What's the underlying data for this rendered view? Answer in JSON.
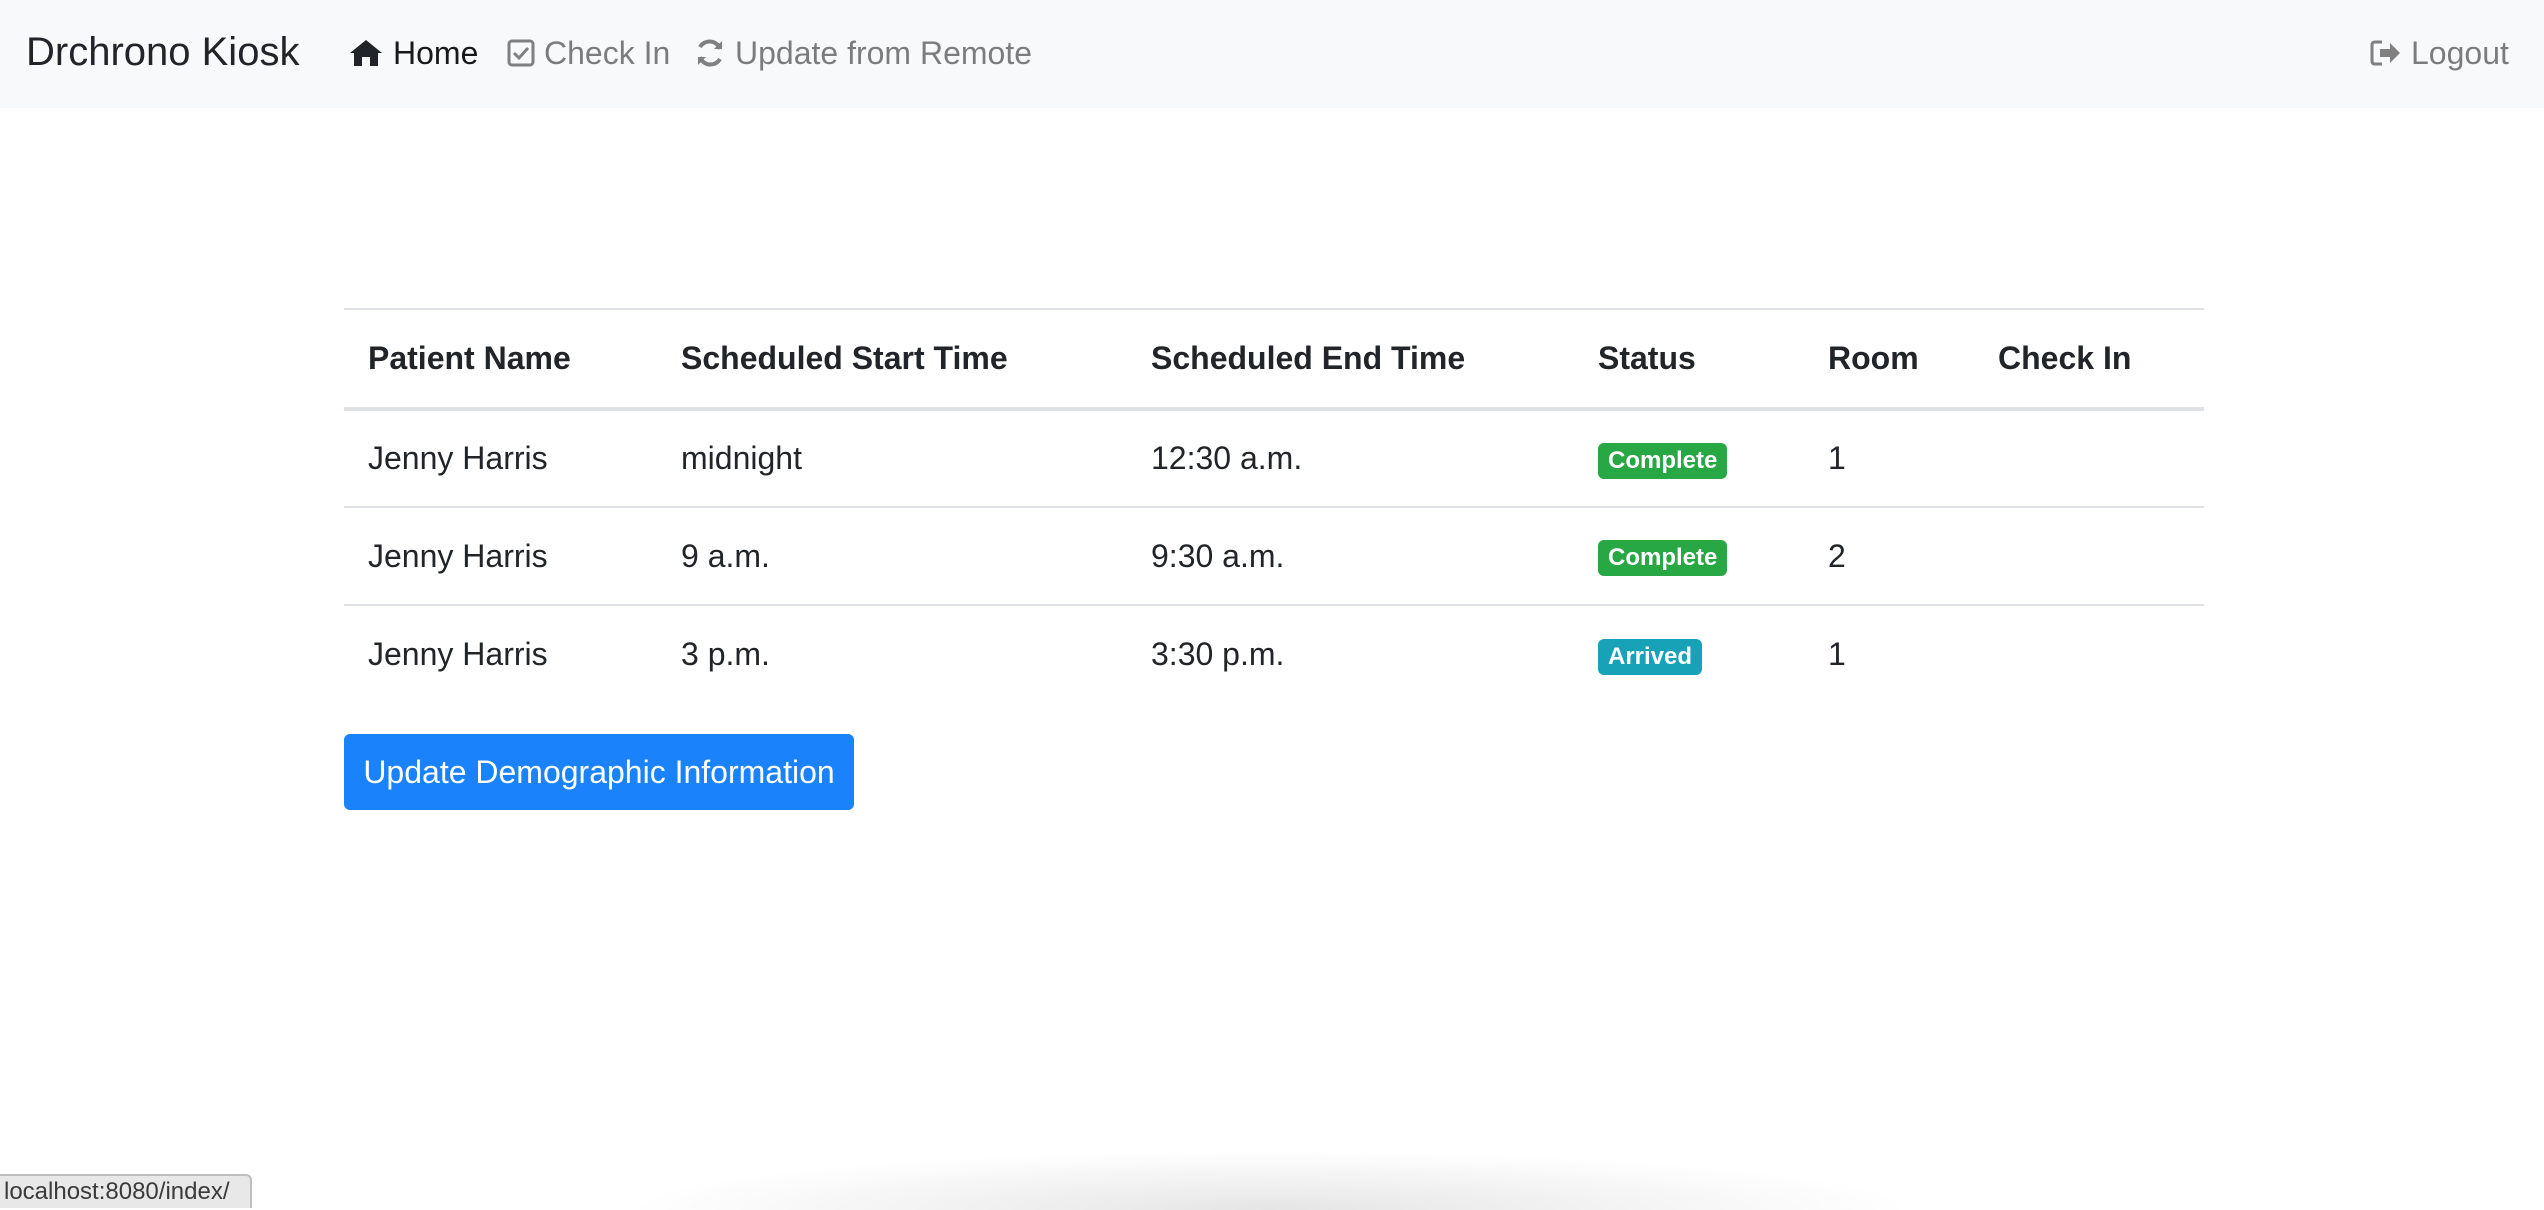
{
  "navbar": {
    "brand": "Drchrono Kiosk",
    "links": [
      {
        "label": "Home",
        "icon": "home-icon",
        "active": true
      },
      {
        "label": "Check In",
        "icon": "check-square-icon",
        "active": false
      },
      {
        "label": "Update from Remote",
        "icon": "refresh-icon",
        "active": false
      }
    ],
    "logout": {
      "label": "Logout",
      "icon": "sign-out-icon"
    }
  },
  "table": {
    "headers": [
      "Patient Name",
      "Scheduled Start Time",
      "Scheduled End Time",
      "Status",
      "Room",
      "Check In"
    ],
    "rows": [
      {
        "patient": "Jenny Harris",
        "start": "midnight",
        "end": "12:30 a.m.",
        "status": "Complete",
        "room": "1",
        "checkin": ""
      },
      {
        "patient": "Jenny Harris",
        "start": "9 a.m.",
        "end": "9:30 a.m.",
        "status": "Complete",
        "room": "2",
        "checkin": ""
      },
      {
        "patient": "Jenny Harris",
        "start": "3 p.m.",
        "end": "3:30 p.m.",
        "status": "Arrived",
        "room": "1",
        "checkin": ""
      }
    ]
  },
  "status_colors": {
    "Complete": "#28a745",
    "Arrived": "#17a2b8"
  },
  "button": {
    "label": "Update Demographic Information",
    "color": "#1a82fb"
  },
  "statusbar": {
    "url": "localhost:8080/index/"
  }
}
